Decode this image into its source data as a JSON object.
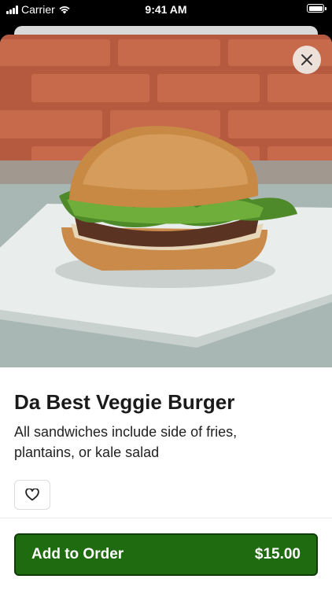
{
  "status_bar": {
    "carrier": "Carrier",
    "time": "9:41 AM"
  },
  "item": {
    "name": "Da Best Veggie Burger",
    "description": "All sandwiches include side of fries, plantains, or kale salad",
    "photo": "veggie-burger-photo"
  },
  "icons": {
    "close": "close-icon",
    "favorite": "heart-icon"
  },
  "order_button": {
    "label": "Add to Order",
    "price": "$15.00"
  },
  "colors": {
    "accent": "#1f6b0f",
    "accent_border": "#0e3c07",
    "text": "#1a1a1a"
  }
}
